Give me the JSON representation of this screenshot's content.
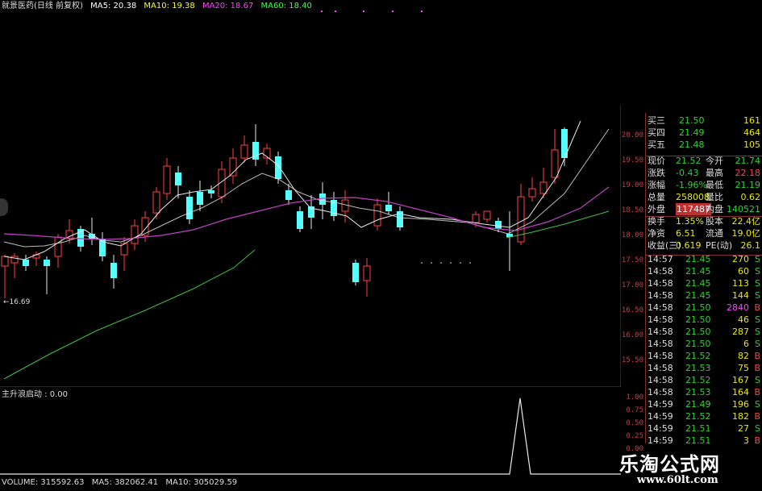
{
  "header": {
    "stock": "就景医药(日线 前复权)",
    "ma5": "MA5: 20.38",
    "ma10": "MA10: 19.38",
    "ma20": "MA20: 18.67",
    "ma60": "MA60: 18.40"
  },
  "price_axis": [
    "20.00",
    "19.50",
    "19.00",
    "18.50",
    "18.00",
    "17.50",
    "17.00",
    "16.50",
    "16.00",
    "15.50"
  ],
  "sub_axis": [
    "1.00",
    "0.75",
    "0.50",
    "0.25",
    "0.00"
  ],
  "low_marker": "←16.69",
  "indicator_title": "主升浪启动 : 0.00",
  "volume": {
    "vol": "VOLUME: 315592.63",
    "ma5": "MA5: 382062.41",
    "ma10": "MA10: 305029.59"
  },
  "orderbook": [
    {
      "label": "买三",
      "price": "21.50",
      "vol": "161"
    },
    {
      "label": "买四",
      "price": "21.49",
      "vol": "464"
    },
    {
      "label": "买五",
      "price": "21.48",
      "vol": "105"
    }
  ],
  "quote": [
    {
      "l1": "现价",
      "v1": "21.52",
      "l2": "今开",
      "v2": "21.74",
      "c1": "g",
      "c2": "g"
    },
    {
      "l1": "涨跌",
      "v1": "-0.43",
      "l2": "最高",
      "v2": "22.18",
      "c1": "g",
      "c2": "r"
    },
    {
      "l1": "涨幅",
      "v1": "-1.96%",
      "l2": "最低",
      "v2": "21.19",
      "c1": "g",
      "c2": "g"
    },
    {
      "l1": "总量",
      "v1": "258008",
      "l2": "量比",
      "v2": "0.62",
      "c1": "y",
      "c2": "y"
    },
    {
      "l1": "外盘",
      "v1": "117487",
      "l2": "内盘",
      "v2": "140521",
      "c1": "r",
      "c2": "g"
    },
    {
      "l1": "换手",
      "v1": "1.35%",
      "l2": "股本",
      "v2": "22.4亿",
      "c1": "y",
      "c2": "y"
    },
    {
      "l1": "净资",
      "v1": "6.51",
      "l2": "流通",
      "v2": "19.0亿",
      "c1": "y",
      "c2": "y"
    },
    {
      "l1": "收益(三)",
      "v1": "0.619",
      "l2": "PE(动)",
      "v2": "26.1",
      "c1": "y",
      "c2": "y"
    }
  ],
  "ticks": [
    {
      "t": "14:57",
      "p": "21.45",
      "v": "270",
      "d": "S",
      "vc": "y",
      "pc": "g"
    },
    {
      "t": "14:58",
      "p": "21.45",
      "v": "60",
      "d": "S",
      "vc": "y",
      "pc": "g"
    },
    {
      "t": "14:58",
      "p": "21.45",
      "v": "113",
      "d": "S",
      "vc": "y",
      "pc": "g"
    },
    {
      "t": "14:58",
      "p": "21.45",
      "v": "144",
      "d": "S",
      "vc": "y",
      "pc": "g"
    },
    {
      "t": "14:58",
      "p": "21.50",
      "v": "2840",
      "d": "B",
      "vc": "m",
      "pc": "g"
    },
    {
      "t": "14:58",
      "p": "21.50",
      "v": "46",
      "d": "S",
      "vc": "y",
      "pc": "g"
    },
    {
      "t": "14:58",
      "p": "21.50",
      "v": "287",
      "d": "S",
      "vc": "y",
      "pc": "g"
    },
    {
      "t": "14:58",
      "p": "21.50",
      "v": "6",
      "d": "S",
      "vc": "y",
      "pc": "g"
    },
    {
      "t": "14:58",
      "p": "21.52",
      "v": "82",
      "d": "B",
      "vc": "y",
      "pc": "g"
    },
    {
      "t": "14:58",
      "p": "21.53",
      "v": "75",
      "d": "B",
      "vc": "y",
      "pc": "g"
    },
    {
      "t": "14:58",
      "p": "21.52",
      "v": "167",
      "d": "S",
      "vc": "y",
      "pc": "g"
    },
    {
      "t": "14:58",
      "p": "21.53",
      "v": "164",
      "d": "B",
      "vc": "y",
      "pc": "g"
    },
    {
      "t": "14:59",
      "p": "21.49",
      "v": "196",
      "d": "S",
      "vc": "y",
      "pc": "g"
    },
    {
      "t": "14:59",
      "p": "21.52",
      "v": "182",
      "d": "B",
      "vc": "y",
      "pc": "g"
    },
    {
      "t": "14:59",
      "p": "21.51",
      "v": "27",
      "d": "S",
      "vc": "y",
      "pc": "g"
    },
    {
      "t": "14:59",
      "p": "21.51",
      "v": "3",
      "d": "B",
      "vc": "y",
      "pc": "g"
    }
  ],
  "watermark": {
    "name": "乐淘公式网",
    "url": "www.60lt.com"
  }
}
